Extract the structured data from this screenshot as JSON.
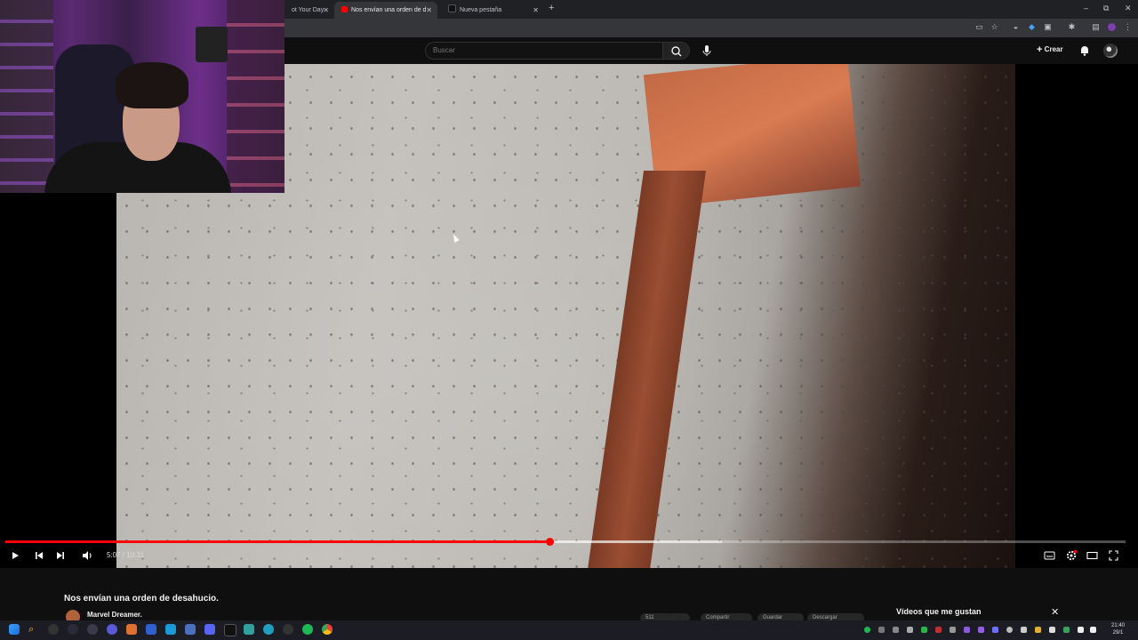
{
  "browser": {
    "tabs": [
      {
        "label": "ot Your Day",
        "active": false
      },
      {
        "label": "Nos envían una orden de d",
        "active": true
      },
      {
        "label": "Nueva pestaña",
        "active": false
      }
    ],
    "new_tab_symbol": "+",
    "window_controls": [
      "–",
      "⧉",
      "✕"
    ]
  },
  "youtube": {
    "search_placeholder": "Buscar",
    "create_label": "Crear",
    "video": {
      "title": "Nos envían una orden de desahucio.",
      "current_time": "5:07",
      "duration": "10:31",
      "time_display": "5:07 / 10:31",
      "progress_fraction": 0.486,
      "buffered_fraction": 0.64
    },
    "channel": {
      "name": "Marvel Dreamer."
    },
    "action_pills": [
      "511",
      "",
      "Compartir",
      "Guardar",
      "Descargar"
    ],
    "liked_panel": {
      "title": "Vídeos que me gustan",
      "close_symbol": "✕"
    }
  },
  "taskbar": {
    "time": "21:40",
    "date": "29/1"
  },
  "colors": {
    "progress": "#ff0000",
    "background": "#0f0f0f",
    "accent_purple": "#7b3fb0"
  }
}
